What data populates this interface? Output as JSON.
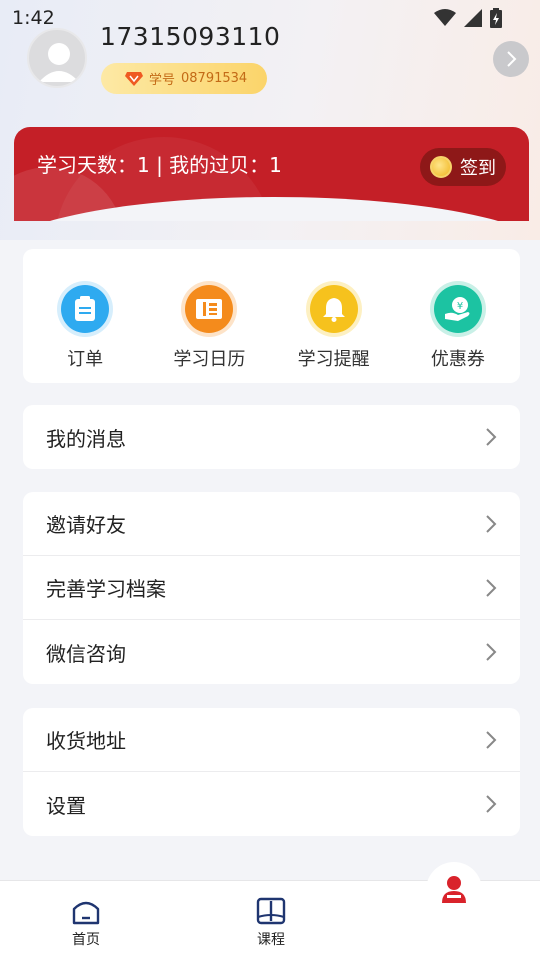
{
  "status": {
    "time": "1:42"
  },
  "profile": {
    "phone": "17315093110",
    "student_label": "学号",
    "student_number": "08791534"
  },
  "banner": {
    "stats_text": "学习天数：1 | 我的过贝：1",
    "signin_label": "签到"
  },
  "quick_actions": [
    {
      "label": "订单",
      "icon": "clipboard-icon",
      "color": "#2eaaf0"
    },
    {
      "label": "学习日历",
      "icon": "ticket-icon",
      "color": "#f48b1c"
    },
    {
      "label": "学习提醒",
      "icon": "bell-icon",
      "color": "#f6c21d"
    },
    {
      "label": "优惠券",
      "icon": "coupon-hand-icon",
      "color": "#1cc3a2"
    }
  ],
  "menu_groups": [
    [
      {
        "label": "我的消息"
      }
    ],
    [
      {
        "label": "邀请好友"
      },
      {
        "label": "完善学习档案"
      },
      {
        "label": "微信咨询"
      }
    ],
    [
      {
        "label": "收货地址"
      },
      {
        "label": "设置"
      }
    ]
  ],
  "bottom_nav": [
    {
      "label": "首页",
      "icon": "home-icon"
    },
    {
      "label": "课程",
      "icon": "book-icon"
    },
    {
      "label": "",
      "icon": "user-icon",
      "active_color": "#d9232b"
    }
  ]
}
